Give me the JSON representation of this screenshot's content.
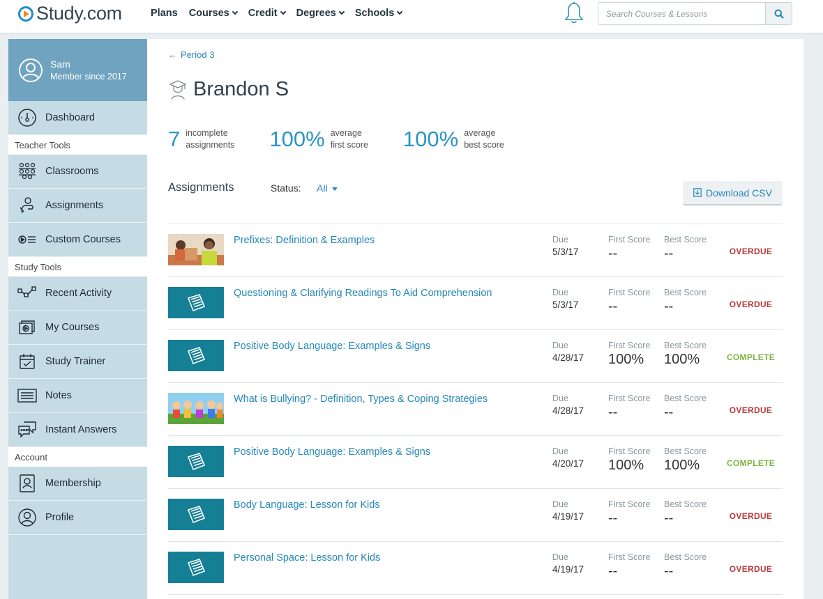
{
  "brand": {
    "name": "Study.com",
    "accent": "#2a94c6",
    "link": "#2488b8",
    "overdue": "#b83a3a",
    "complete": "#7cb342"
  },
  "nav": {
    "items": [
      {
        "label": "Plans",
        "dropdown": false
      },
      {
        "label": "Courses",
        "dropdown": true
      },
      {
        "label": "Credit",
        "dropdown": true
      },
      {
        "label": "Degrees",
        "dropdown": true
      },
      {
        "label": "Schools",
        "dropdown": true
      }
    ],
    "search_placeholder": "Search Courses & Lessons"
  },
  "sidebar": {
    "user": {
      "name": "Sam",
      "since": "Member since 2017"
    },
    "dashboard": "Dashboard",
    "teacher_tools_label": "Teacher Tools",
    "teacher_tools": [
      "Classrooms",
      "Assignments",
      "Custom Courses"
    ],
    "study_tools_label": "Study Tools",
    "study_tools": [
      "Recent Activity",
      "My Courses",
      "Study Trainer",
      "Notes",
      "Instant Answers"
    ],
    "account_label": "Account",
    "account": [
      "Membership",
      "Profile"
    ]
  },
  "main": {
    "back_label": "Period 3",
    "student_name": "Brandon S",
    "stats": [
      {
        "value": "7",
        "line1": "incomplete",
        "line2": "assignments"
      },
      {
        "value": "100%",
        "line1": "average",
        "line2": "first score"
      },
      {
        "value": "100%",
        "line1": "average",
        "line2": "best score"
      }
    ],
    "assignments_title": "Assignments",
    "status_label": "Status:",
    "status_value": "All",
    "download_label": "Download CSV",
    "col_due": "Due",
    "col_first": "First Score",
    "col_best": "Best Score",
    "rows": [
      {
        "title": "Prefixes: Definition & Examples",
        "due": "5/3/17",
        "first": "--",
        "best": "--",
        "state": "OVERDUE",
        "thumb": "photo-teacher"
      },
      {
        "title": "Questioning & Clarifying Readings To Aid Comprehension",
        "due": "5/3/17",
        "first": "--",
        "best": "--",
        "state": "OVERDUE",
        "thumb": "worksheet-icon"
      },
      {
        "title": "Positive Body Language: Examples & Signs",
        "due": "4/28/17",
        "first": "100%",
        "best": "100%",
        "state": "COMPLETE",
        "thumb": "worksheet-icon"
      },
      {
        "title": "What is Bullying? - Definition, Types & Coping Strategies",
        "due": "4/28/17",
        "first": "--",
        "best": "--",
        "state": "OVERDUE",
        "thumb": "photo-kids"
      },
      {
        "title": "Positive Body Language: Examples & Signs",
        "due": "4/20/17",
        "first": "100%",
        "best": "100%",
        "state": "COMPLETE",
        "thumb": "worksheet-icon"
      },
      {
        "title": "Body Language: Lesson for Kids",
        "due": "4/19/17",
        "first": "--",
        "best": "--",
        "state": "OVERDUE",
        "thumb": "worksheet-icon"
      },
      {
        "title": "Personal Space: Lesson for Kids",
        "due": "4/19/17",
        "first": "--",
        "best": "--",
        "state": "OVERDUE",
        "thumb": "worksheet-icon"
      }
    ]
  }
}
